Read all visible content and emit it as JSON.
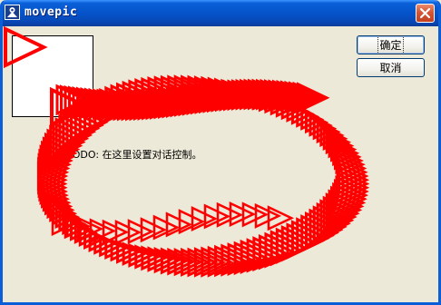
{
  "window": {
    "title": "movepic",
    "icon": "app-icon",
    "close_icon": "close-icon"
  },
  "buttons": {
    "ok_label": "确定",
    "cancel_label": "取消"
  },
  "static_text": "TODO: 在这里设置对话控制。",
  "drawing": {
    "color": "#ff0000",
    "shape": "triangle-arrow"
  },
  "colors": {
    "titlebar": "#0a5fd8",
    "dialog_bg": "#ece9d8",
    "close_button": "#d65536"
  }
}
